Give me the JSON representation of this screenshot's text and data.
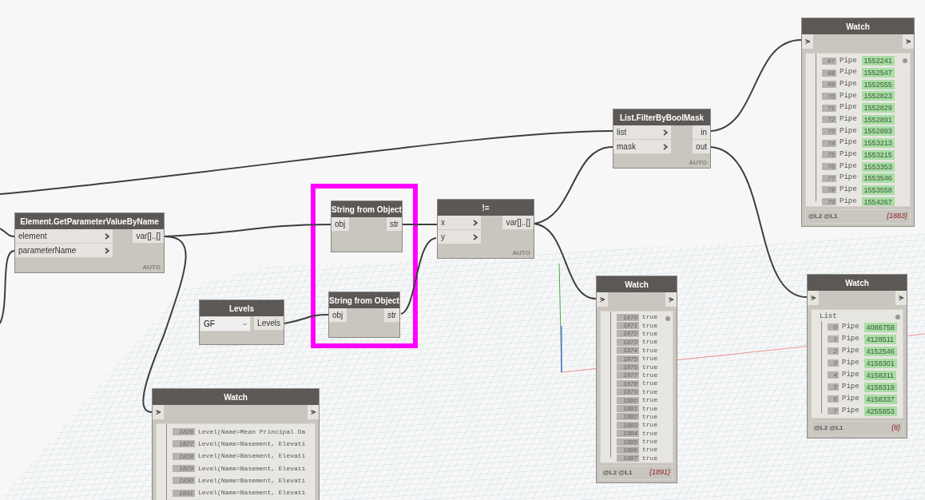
{
  "nodes": [
    {
      "kind": "function",
      "title": "Element.GetParameterValueByName",
      "inputs": [
        "element",
        "parameterName"
      ],
      "outputs": [
        "var[]..[]"
      ],
      "chevrons": true,
      "lacing": "AUTO"
    },
    {
      "kind": "function",
      "title": "String from Object",
      "inputs": [
        "obj"
      ],
      "outputs": [
        "str"
      ],
      "chevrons": false
    },
    {
      "kind": "function",
      "title": "String from Object",
      "inputs": [
        "obj"
      ],
      "outputs": [
        "str"
      ],
      "chevrons": false
    },
    {
      "kind": "dropdown",
      "title": "Levels",
      "value": "GF",
      "outputs": [
        "Levels"
      ]
    },
    {
      "kind": "function",
      "title": "!=",
      "inputs": [
        "x",
        "y"
      ],
      "outputs": [
        "var[]..[]"
      ],
      "chevrons": true,
      "lacing": "AUTO"
    },
    {
      "kind": "function",
      "title": "List.FilterByBoolMask",
      "inputs": [
        "list",
        "mask"
      ],
      "outputs": [
        "in",
        "out"
      ],
      "chevrons": true,
      "lacing": "AUTO"
    },
    {
      "kind": "watch",
      "title": "Watch",
      "levels": "@L2 @L1",
      "count": "{1883}",
      "items": [
        {
          "index": "67",
          "type": "Pipe",
          "value": "1552241"
        },
        {
          "index": "68",
          "type": "Pipe",
          "value": "1552547"
        },
        {
          "index": "69",
          "type": "Pipe",
          "value": "1552555"
        },
        {
          "index": "70",
          "type": "Pipe",
          "value": "1552823"
        },
        {
          "index": "71",
          "type": "Pipe",
          "value": "1552829"
        },
        {
          "index": "72",
          "type": "Pipe",
          "value": "1552891"
        },
        {
          "index": "73",
          "type": "Pipe",
          "value": "1552893"
        },
        {
          "index": "74",
          "type": "Pipe",
          "value": "1553213"
        },
        {
          "index": "75",
          "type": "Pipe",
          "value": "1553215"
        },
        {
          "index": "76",
          "type": "Pipe",
          "value": "1553353"
        },
        {
          "index": "77",
          "type": "Pipe",
          "value": "1553546"
        },
        {
          "index": "78",
          "type": "Pipe",
          "value": "1553558"
        },
        {
          "index": "79",
          "type": "Pipe",
          "value": "1554267"
        }
      ]
    },
    {
      "kind": "watch",
      "title": "Watch",
      "levels": "@L2 @L1",
      "count": "{1891}",
      "items": [
        {
          "index": "1870",
          "text": "true"
        },
        {
          "index": "1871",
          "text": "true"
        },
        {
          "index": "1872",
          "text": "true"
        },
        {
          "index": "1873",
          "text": "true"
        },
        {
          "index": "1874",
          "text": "true"
        },
        {
          "index": "1875",
          "text": "true"
        },
        {
          "index": "1876",
          "text": "true"
        },
        {
          "index": "1877",
          "text": "true"
        },
        {
          "index": "1878",
          "text": "true"
        },
        {
          "index": "1879",
          "text": "true"
        },
        {
          "index": "1880",
          "text": "true"
        },
        {
          "index": "1881",
          "text": "true"
        },
        {
          "index": "1882",
          "text": "true"
        },
        {
          "index": "1883",
          "text": "true"
        },
        {
          "index": "1884",
          "text": "true"
        },
        {
          "index": "1885",
          "text": "true"
        },
        {
          "index": "1886",
          "text": "true"
        },
        {
          "index": "1887",
          "text": "true"
        }
      ]
    },
    {
      "kind": "watch",
      "title": "Watch",
      "list_label": "List",
      "levels": "@L2 @L1",
      "count": "{8}",
      "items": [
        {
          "index": "0",
          "type": "Pipe",
          "value": "4086758"
        },
        {
          "index": "1",
          "type": "Pipe",
          "value": "4128511"
        },
        {
          "index": "2",
          "type": "Pipe",
          "value": "4152546"
        },
        {
          "index": "3",
          "type": "Pipe",
          "value": "4158301"
        },
        {
          "index": "4",
          "type": "Pipe",
          "value": "4158311"
        },
        {
          "index": "5",
          "type": "Pipe",
          "value": "4158319"
        },
        {
          "index": "6",
          "type": "Pipe",
          "value": "4158337"
        },
        {
          "index": "7",
          "type": "Pipe",
          "value": "4255853"
        }
      ]
    },
    {
      "kind": "watch",
      "title": "Watch",
      "items": [
        {
          "index": "1826",
          "text": "Level(Name=Mean Principal Da"
        },
        {
          "index": "1827",
          "text": "Level(Name=Basement, Elevati"
        },
        {
          "index": "1828",
          "text": "Level(Name=Basement, Elevati"
        },
        {
          "index": "1829",
          "text": "Level(Name=Basement, Elevati"
        },
        {
          "index": "1830",
          "text": "Level(Name=Basement, Elevati"
        },
        {
          "index": "1831",
          "text": "Level(Name=Basement, Elevati"
        }
      ]
    }
  ]
}
